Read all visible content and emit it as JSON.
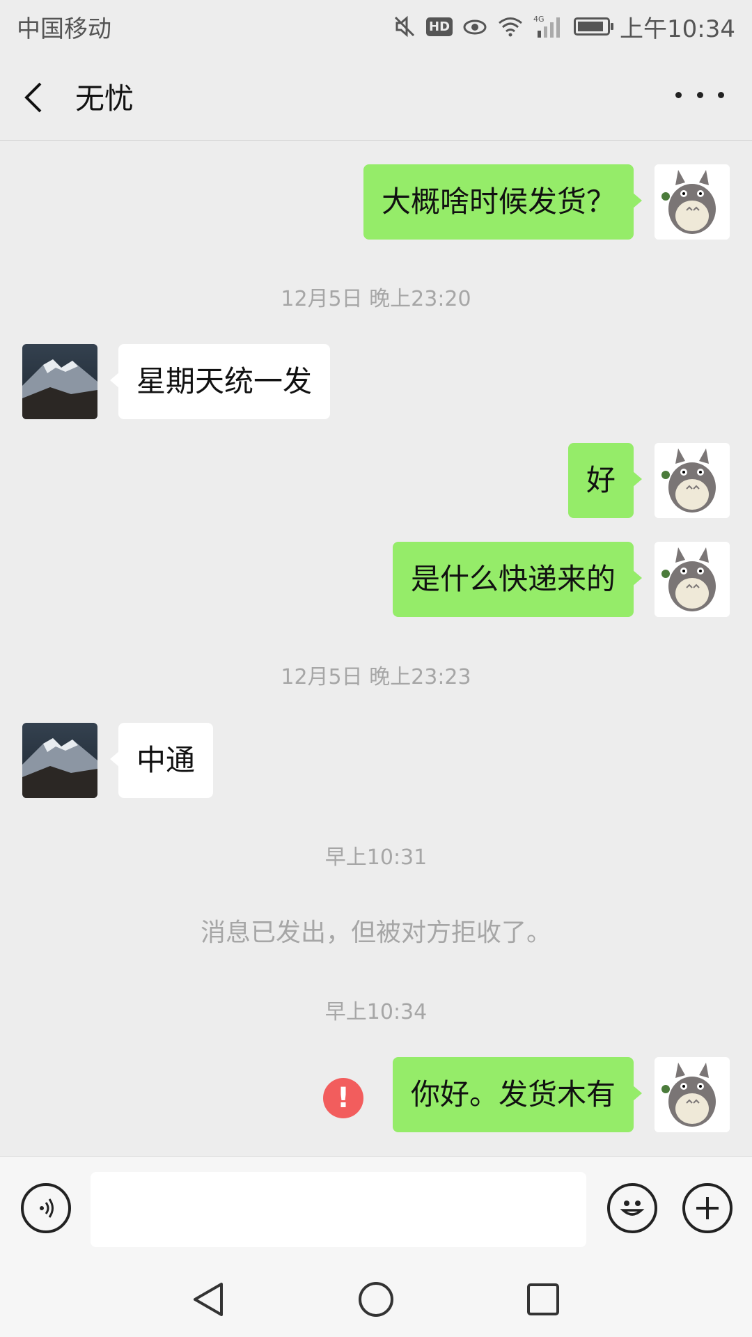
{
  "status_bar": {
    "carrier": "中国移动",
    "network": "4G",
    "hd_badge": "HD",
    "time": "上午10:34",
    "icons": [
      "mute-icon",
      "hd-icon",
      "eye-icon",
      "wifi-icon",
      "signal-icon",
      "battery-icon"
    ]
  },
  "header": {
    "title": "无忧"
  },
  "messages": [
    {
      "side": "me",
      "text": "大概啥时候发货？"
    },
    {
      "type": "timestamp",
      "text": "12月5日 晚上23:20"
    },
    {
      "side": "other",
      "text": "星期天统一发"
    },
    {
      "side": "me",
      "text": "好"
    },
    {
      "side": "me",
      "text": "是什么快递来的"
    },
    {
      "type": "timestamp",
      "text": "12月5日 晚上23:23"
    },
    {
      "side": "other",
      "text": "中通"
    },
    {
      "type": "timestamp",
      "text": "早上10:31"
    },
    {
      "type": "system",
      "text": "消息已发出，但被对方拒收了。"
    },
    {
      "type": "timestamp",
      "text": "早上10:34"
    },
    {
      "side": "me",
      "text": "你好。发货木有",
      "error_badge": "!"
    }
  ],
  "input_bar": {
    "value": "",
    "icons": [
      "voice-icon",
      "emoji-icon",
      "plus-icon"
    ]
  },
  "nav_bar": {
    "icons": [
      "nav-back-icon",
      "nav-home-icon",
      "nav-recents-icon"
    ]
  },
  "colors": {
    "background": "#ededed",
    "my_bubble": "#95ec69",
    "other_bubble": "#ffffff",
    "timestamp": "#a6a6a6",
    "error": "#f25d5d"
  }
}
